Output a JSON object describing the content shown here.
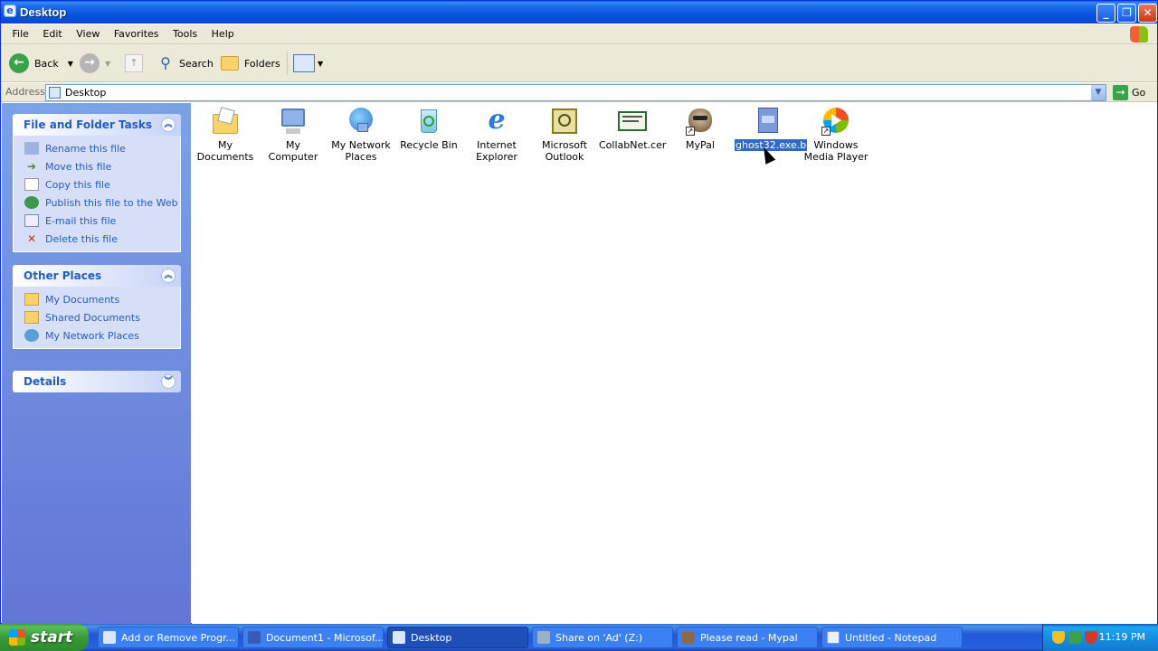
{
  "window": {
    "title": "Desktop"
  },
  "menubar": {
    "items": [
      "File",
      "Edit",
      "View",
      "Favorites",
      "Tools",
      "Help"
    ]
  },
  "toolbar": {
    "back": "Back",
    "search": "Search",
    "folders": "Folders"
  },
  "address": {
    "label": "Address",
    "value": "Desktop",
    "go": "Go"
  },
  "sidebar": {
    "file_tasks": {
      "title": "File and Folder Tasks",
      "items": [
        "Rename this file",
        "Move this file",
        "Copy this file",
        "Publish this file to the Web",
        "E-mail this file",
        "Delete this file"
      ]
    },
    "other_places": {
      "title": "Other Places",
      "items": [
        "My Documents",
        "Shared Documents",
        "My Network Places"
      ]
    },
    "details": {
      "title": "Details"
    }
  },
  "desktop": {
    "icons": [
      {
        "line1": "My Documents",
        "line2": "",
        "icon": "my-documents-icon"
      },
      {
        "line1": "My Computer",
        "line2": "",
        "icon": "my-computer-icon"
      },
      {
        "line1": "My Network",
        "line2": "Places",
        "icon": "network-places-icon"
      },
      {
        "line1": "Recycle Bin",
        "line2": "",
        "icon": "recycle-bin-icon"
      },
      {
        "line1": "Internet",
        "line2": "Explorer",
        "icon": "internet-explorer-icon"
      },
      {
        "line1": "Microsoft",
        "line2": "Outlook",
        "icon": "outlook-icon"
      },
      {
        "line1": "CollabNet.cer",
        "line2": "",
        "icon": "certificate-icon"
      },
      {
        "line1": "MyPal",
        "line2": "",
        "icon": "mypal-icon"
      },
      {
        "line1": "ghost32.exe.b",
        "line2": "",
        "icon": "file-icon",
        "selected": true
      },
      {
        "line1": "Windows",
        "line2": "Media Player",
        "icon": "media-player-icon"
      }
    ]
  },
  "taskbar": {
    "start": "start",
    "items": [
      "Add or Remove Progr...",
      "Document1 - Microsof...",
      "Desktop",
      "Share on 'Ad' (Z:)",
      "Please read - Mypal",
      "Untitled - Notepad"
    ],
    "active_index": 2,
    "clock": "11:19 PM"
  },
  "colors": {
    "sidebar": "#6d8ce0",
    "selection": "#316ac5",
    "link": "#215dc6"
  }
}
